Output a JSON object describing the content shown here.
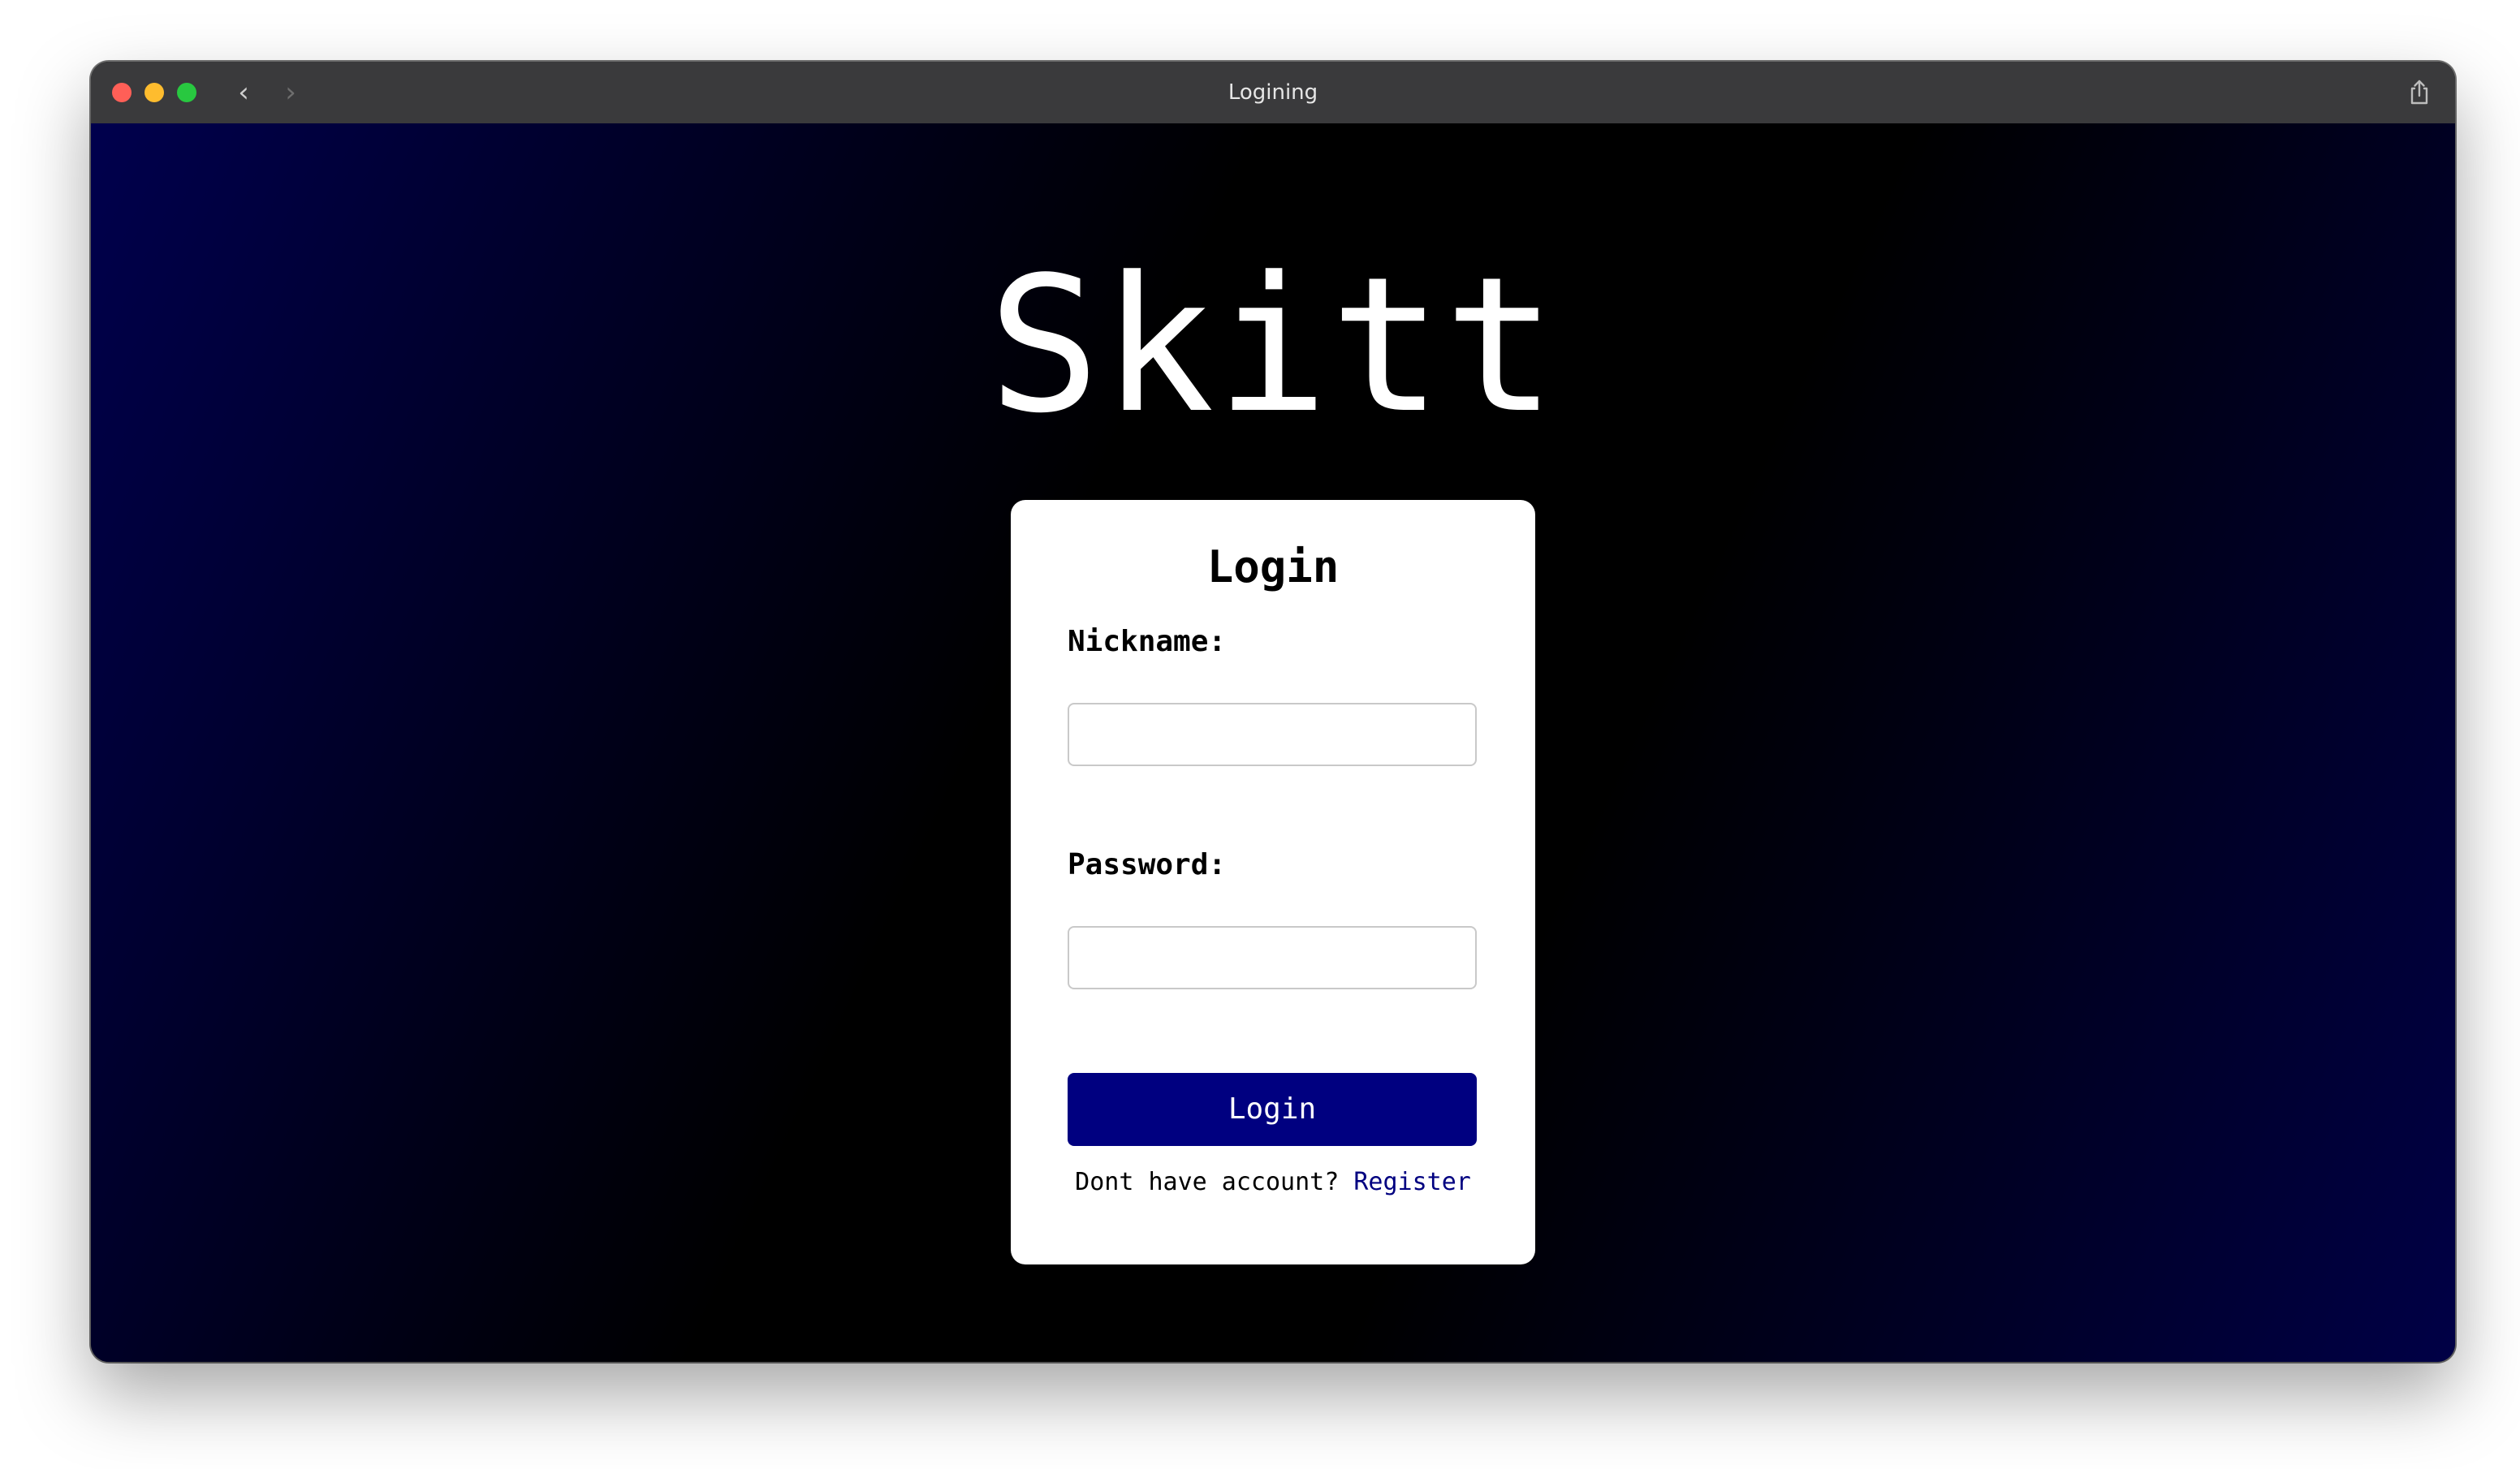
{
  "window": {
    "title": "Logining"
  },
  "colors": {
    "accent": "#000080",
    "background_gradient_start": "#00004d",
    "background_gradient_mid": "#000000",
    "background_gradient_end": "#000046",
    "titlebar": "#3a3a3c",
    "traffic_red": "#ff5f57",
    "traffic_yellow": "#febc2e",
    "traffic_green": "#28c840",
    "nav_back": "#cfcfcf",
    "nav_forward": "#6e6e6e"
  },
  "icons": {
    "back": "chevron-left-icon",
    "forward": "chevron-right-icon",
    "share": "share-icon"
  },
  "brand": {
    "name": "Skitt"
  },
  "login_form": {
    "heading": "Login",
    "nickname_label": "Nickname:",
    "nickname_value": "",
    "password_label": "Password:",
    "password_value": "",
    "submit_label": "Login",
    "register_prompt": "Dont have account?",
    "register_link": "Register"
  }
}
